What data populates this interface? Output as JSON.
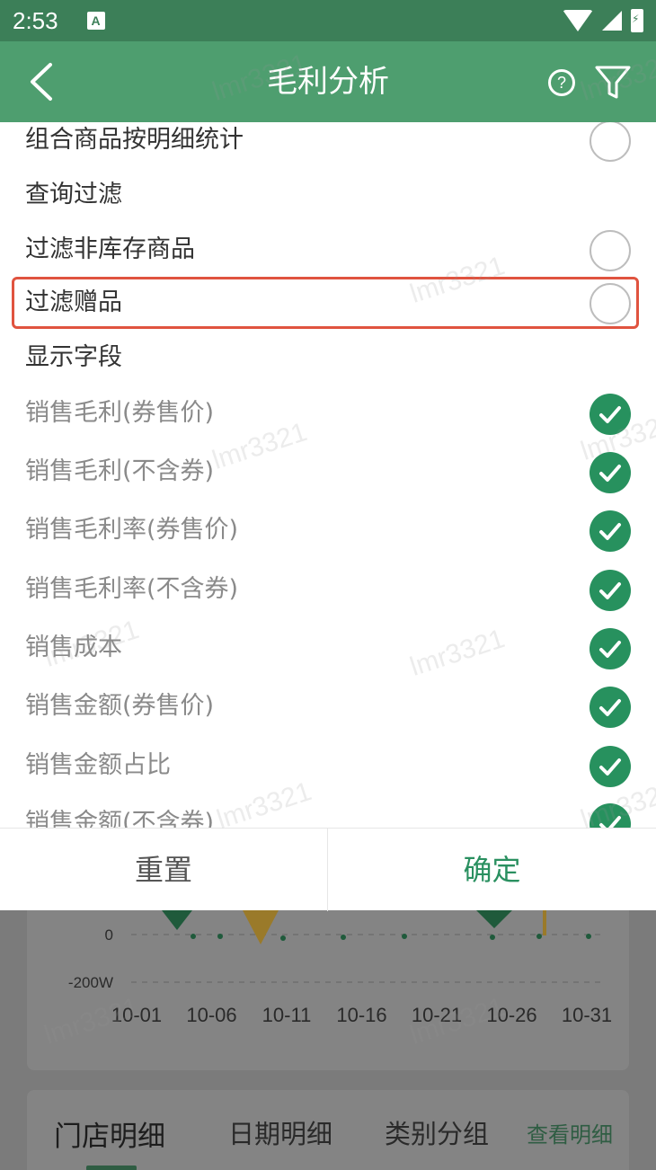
{
  "status_bar": {
    "time": "2:53",
    "app_icon_letter": "A"
  },
  "header": {
    "title": "毛利分析",
    "help_label": "?"
  },
  "panel": {
    "rows": [
      {
        "label": "组合商品按明细统计",
        "kind": "radio"
      },
      {
        "label": "查询过滤",
        "kind": "section"
      },
      {
        "label": "过滤非库存商品",
        "kind": "radio"
      },
      {
        "label": "过滤赠品",
        "kind": "radio"
      },
      {
        "label": "显示字段",
        "kind": "section"
      },
      {
        "label": "销售毛利(券售价)",
        "kind": "check"
      },
      {
        "label": "销售毛利(不含券)",
        "kind": "check"
      },
      {
        "label": "销售毛利率(券售价)",
        "kind": "check"
      },
      {
        "label": "销售毛利率(不含券)",
        "kind": "check"
      },
      {
        "label": "销售成本",
        "kind": "check"
      },
      {
        "label": "销售金额(券售价)",
        "kind": "check"
      },
      {
        "label": "销售金额占比",
        "kind": "check"
      },
      {
        "label": "销售金额(不含券)",
        "kind": "check"
      }
    ]
  },
  "buttons": {
    "reset": "重置",
    "confirm": "确定"
  },
  "background_page": {
    "chart": {
      "y_ticks": [
        "0",
        "-200W"
      ],
      "x_ticks": [
        "10-01",
        "10-06",
        "10-11",
        "10-16",
        "10-21",
        "10-26",
        "10-31"
      ]
    },
    "tabs": [
      "门店明细",
      "日期明细",
      "类别分组"
    ],
    "view_detail": "查看明细"
  },
  "watermark": "lmr3321",
  "colors": {
    "header": "#4e9e6f",
    "status_bar": "#3c7f58",
    "check": "#27915e",
    "highlight": "#e0533f"
  }
}
